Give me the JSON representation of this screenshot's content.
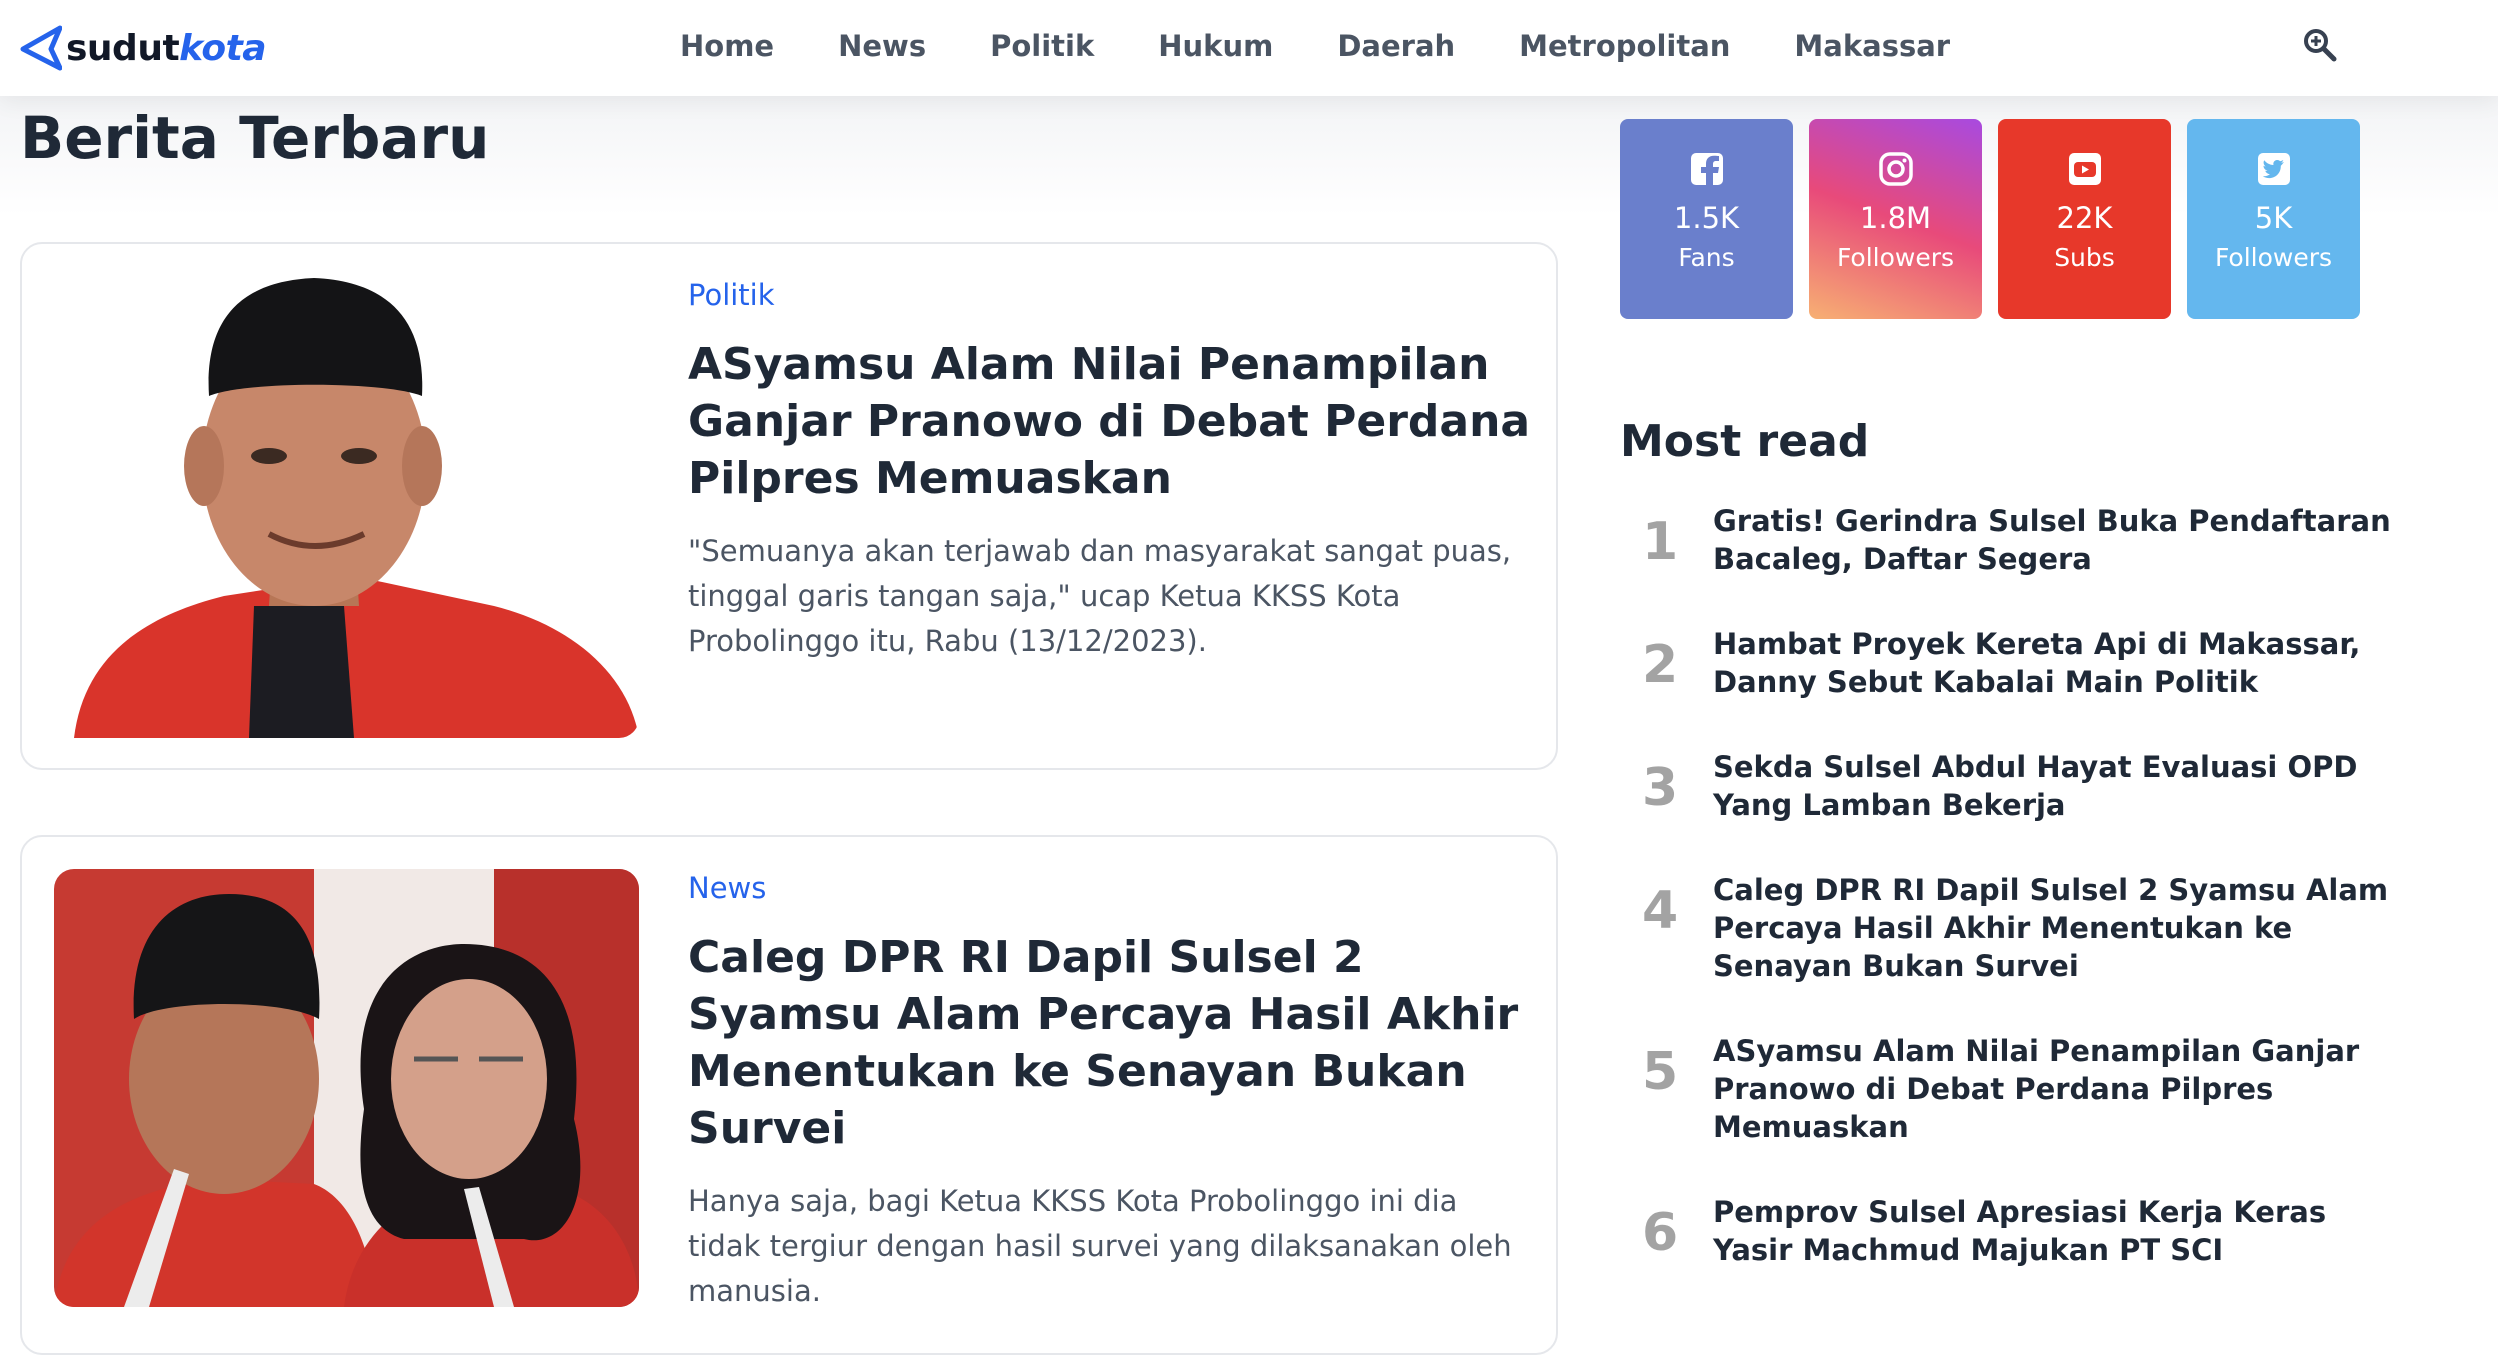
{
  "brand": {
    "name_part1": "sudut",
    "name_part2": "kota",
    "accent": "#2563eb"
  },
  "nav": {
    "items": [
      "Home",
      "News",
      "Politik",
      "Hukum",
      "Daerah",
      "Metropolitan",
      "Makassar"
    ]
  },
  "search": {
    "icon": "search-icon"
  },
  "section_title": "Berita Terbaru",
  "articles": [
    {
      "category": "Politik",
      "title": "ASyamsu Alam Nilai Penampilan Ganjar Pranowo di Debat Perdana Pilpres Memuaskan",
      "excerpt": "\"Semuanya akan terjawab dan masyarakat sangat puas, tinggal garis tangan saja,\" ucap Ketua KKSS Kota Probolinggo itu, Rabu (13/12/2023)."
    },
    {
      "category": "News",
      "title": "Caleg DPR RI Dapil Sulsel 2 Syamsu Alam Percaya Hasil Akhir Menentukan ke Senayan Bukan Survei",
      "excerpt": "Hanya saja, bagi Ketua KKSS Kota Probolinggo ini dia tidak tergiur dengan hasil survei yang dilaksanakan oleh manusia."
    }
  ],
  "social": [
    {
      "network": "facebook",
      "icon": "facebook-icon",
      "count": "1.5K",
      "label": "Fans",
      "color": "#6a7fcc"
    },
    {
      "network": "instagram",
      "icon": "instagram-icon",
      "count": "1.8M",
      "label": "Followers",
      "color": "#d9508a"
    },
    {
      "network": "youtube",
      "icon": "youtube-icon",
      "count": "22K",
      "label": "Subs",
      "color": "#e7382a"
    },
    {
      "network": "twitter",
      "icon": "twitter-icon",
      "count": "5K",
      "label": "Followers",
      "color": "#64b7ee"
    }
  ],
  "most_read": {
    "title": "Most read",
    "items": [
      {
        "rank": "1",
        "title": "Gratis! Gerindra Sulsel Buka Pendaftaran Bacaleg, Daftar Segera"
      },
      {
        "rank": "2",
        "title": "Hambat Proyek Kereta Api di Makassar, Danny Sebut Kabalai Main Politik"
      },
      {
        "rank": "3",
        "title": "Sekda Sulsel Abdul Hayat Evaluasi OPD Yang Lamban Bekerja"
      },
      {
        "rank": "4",
        "title": "Caleg DPR RI Dapil Sulsel 2 Syamsu Alam Percaya Hasil Akhir Menentukan ke Senayan Bukan Survei"
      },
      {
        "rank": "5",
        "title": "ASyamsu Alam Nilai Penampilan Ganjar Pranowo di Debat Perdana Pilpres Memuaskan"
      },
      {
        "rank": "6",
        "title": "Pemprov Sulsel Apresiasi Kerja Keras Yasir Machmud Majukan PT SCI"
      }
    ]
  }
}
